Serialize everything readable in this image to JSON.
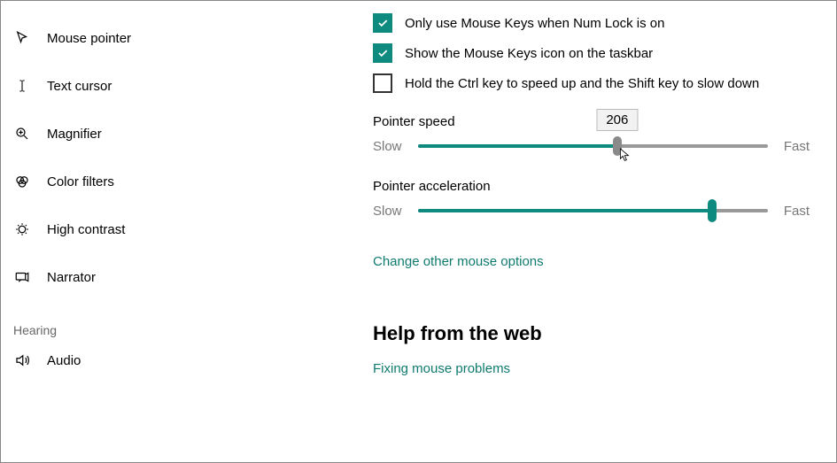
{
  "sidebar": {
    "items": [
      {
        "label": "Mouse pointer",
        "icon": "mouse-pointer-icon"
      },
      {
        "label": "Text cursor",
        "icon": "text-cursor-icon"
      },
      {
        "label": "Magnifier",
        "icon": "magnifier-icon"
      },
      {
        "label": "Color filters",
        "icon": "color-filters-icon"
      },
      {
        "label": "High contrast",
        "icon": "high-contrast-icon"
      },
      {
        "label": "Narrator",
        "icon": "narrator-icon"
      }
    ],
    "hearing_header": "Hearing",
    "audio_item": {
      "label": "Audio",
      "icon": "audio-icon"
    }
  },
  "main": {
    "checkboxes": [
      {
        "checked": true,
        "label": "Only use Mouse Keys when Num Lock is on"
      },
      {
        "checked": true,
        "label": "Show the Mouse Keys icon on the taskbar"
      },
      {
        "checked": false,
        "label": "Hold the Ctrl key to speed up and the Shift key to slow down"
      }
    ],
    "pointer_speed": {
      "label": "Pointer speed",
      "slow": "Slow",
      "fast": "Fast",
      "value": "206",
      "percent": 57
    },
    "pointer_accel": {
      "label": "Pointer acceleration",
      "slow": "Slow",
      "fast": "Fast",
      "percent": 84
    },
    "change_link": "Change other mouse options",
    "help_heading": "Help from the web",
    "help_link": "Fixing mouse problems"
  },
  "colors": {
    "accent": "#0f8a7e"
  }
}
